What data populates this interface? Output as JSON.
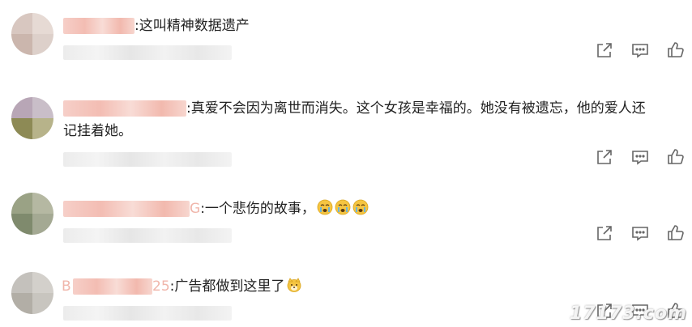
{
  "comments": [
    {
      "text": ":这叫精神数据遗产",
      "emojis": []
    },
    {
      "text_line1": ":真爱不会因为离世而消失。这个女孩是幸福的。她没有被遗忘，他的爱人还",
      "text_line2": "记挂着她。",
      "emojis": []
    },
    {
      "name_tail": "G",
      "text": ":一个悲伤的故事，",
      "emojis": [
        "crying-face",
        "crying-face",
        "crying-face"
      ]
    },
    {
      "name_head": "B",
      "name_tail": "25",
      "text": ":广告都做到这里了",
      "emojis": [
        "dog-face"
      ]
    }
  ],
  "actions": {
    "share_icon": "share-icon",
    "comment_icon": "comment-icon",
    "like_icon": "thumbs-up-icon"
  },
  "watermark": "17173.com",
  "colors": {
    "icon": "#666666",
    "text": "#222222",
    "emoji": "#f5c542"
  }
}
